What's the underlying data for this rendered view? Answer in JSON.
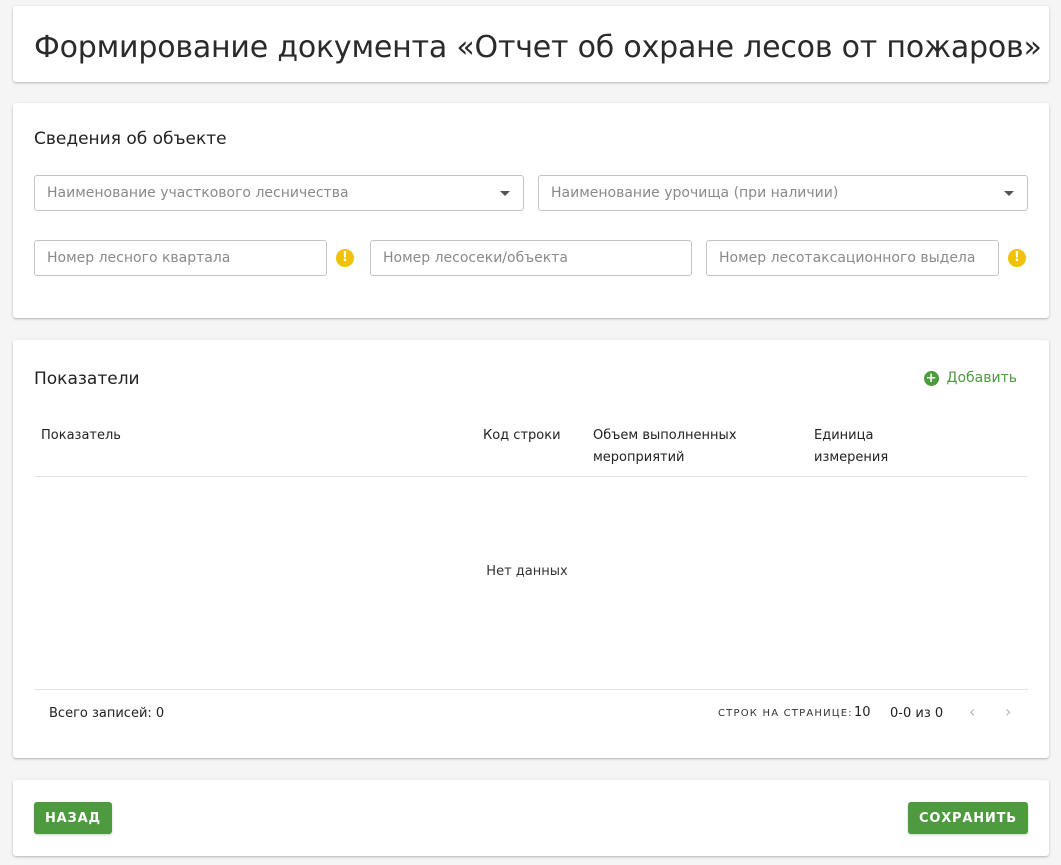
{
  "page": {
    "title": "Формирование документа «Отчет об охране лесов от пожаров»"
  },
  "object_info": {
    "section_title": "Сведения об объекте",
    "forestry_select": {
      "placeholder": "Наименование участкового лесничества",
      "value": ""
    },
    "tract_select": {
      "placeholder": "Наименование урочища (при наличии)",
      "value": ""
    },
    "quarter_input": {
      "placeholder": "Номер лесного квартала",
      "value": ""
    },
    "plot_input": {
      "placeholder": "Номер лесосеки/объекта",
      "value": ""
    },
    "allotment_input": {
      "placeholder": "Номер лесотаксационного выдела",
      "value": ""
    },
    "warning_glyph": "!"
  },
  "indicators": {
    "section_title": "Показатели",
    "add_label": "Добавить",
    "add_glyph": "+",
    "columns": [
      {
        "line1": "Показатель",
        "line2": ""
      },
      {
        "line1": "Код строки",
        "line2": ""
      },
      {
        "line1": "Объем выполненных",
        "line2": "мероприятий"
      },
      {
        "line1": "Единица",
        "line2": "измерения"
      }
    ],
    "rows": [],
    "empty_text": "Нет данных",
    "total_label": "Всего записей: 0",
    "rows_per_page_label": "СТРОК НА СТРАНИЦЕ:",
    "rows_per_page_value": "10",
    "range_text": "0-0 из 0",
    "prev_glyph": "‹",
    "next_glyph": "›"
  },
  "actions": {
    "back_label": "НАЗАД",
    "save_label": "СОХРАНИТЬ"
  },
  "colors": {
    "accent": "#4e9a3f",
    "warning": "#f2c200",
    "background": "#f5f5f5"
  }
}
